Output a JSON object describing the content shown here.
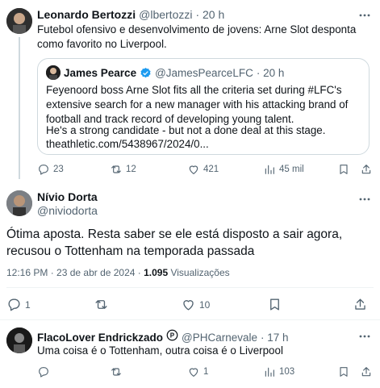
{
  "tweet1": {
    "author_name": "Leonardo Bertozzi",
    "author_handle": "@lbertozzi",
    "time": "· 20 h",
    "text": "Futebol ofensivo e desenvolvimento de jovens: Arne Slot desponta como favorito no Liverpool.",
    "quote": {
      "author_name": "James Pearce",
      "author_handle": "@JamesPearceLFC",
      "time": "· 20 h",
      "line1": "Feyenoord boss Arne Slot fits all the criteria set during #LFC's extensive search for a new manager with his attacking brand of football and track record of developing young talent.",
      "line2": "He's a strong candidate - but not a done deal at this stage.",
      "link": "theathletic.com/5438967/2024/0..."
    },
    "actions": {
      "replies": "23",
      "retweets": "12",
      "likes": "421",
      "views": "45 mil"
    }
  },
  "tweet2": {
    "author_name": "Nívio Dorta",
    "author_handle": "@niviodorta",
    "text": "Ótima aposta. Resta saber se ele está disposto a sair agora, recusou o Tottenham na temporada passada",
    "meta_time": "12:16 PM · 23 de abr de 2024 · ",
    "meta_views": "1.095",
    "meta_views_label": " Visualizações",
    "actions": {
      "replies": "1",
      "retweets": "",
      "likes": "10"
    }
  },
  "tweet3": {
    "author_name": "FlacoLover Endrickzado",
    "author_handle": "@PHCarnevale",
    "time": "· 17 h",
    "text": "Uma coisa é o Tottenham, outra coisa é o Liverpool",
    "actions": {
      "replies": "",
      "retweets": "",
      "likes": "1",
      "views": "103"
    }
  },
  "colors": {
    "accent": "#1d9bf0",
    "muted": "#536471",
    "border": "#cfd9de"
  }
}
